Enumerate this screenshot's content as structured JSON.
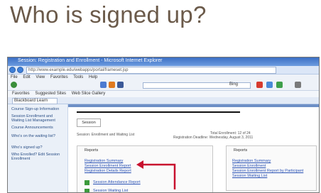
{
  "slide": {
    "title": "Who is signed up?"
  },
  "browser": {
    "title_text": "Session: Registration and Enrollment - Microsoft Internet Explorer",
    "address": "http://www.example.edu/webapps/portal/frameset.jsp",
    "menu": [
      "File",
      "Edit",
      "View",
      "Favorites",
      "Tools",
      "Help"
    ],
    "search_label": "Bing",
    "favorites": [
      "Favorites",
      "Suggested Sites",
      "Web Slice Gallery"
    ],
    "tab_label": "Blackboard Learn"
  },
  "left_nav": {
    "items": [
      "Course Sign-up Information",
      "Session Enrollment and Waiting List Management",
      "Course Announcements",
      "Who's on the waiting list?",
      "Who's signed up?",
      "Who Enrolled? Edit Session Enrollment"
    ]
  },
  "page": {
    "nav_box": "Session",
    "line_a": "Session: Enrollment and Waiting List",
    "line_b": "Total Enrollment: 12 of 24",
    "line_c": "Registration Deadline: Wednesday, August 3, 2011"
  },
  "panels": {
    "left": {
      "heading": "Reports",
      "links": [
        "Registration Summary",
        "Session Enrollment Report",
        "Registration Details Report"
      ],
      "extra": [
        "Session Attendance Report",
        "Session Waiting List"
      ]
    },
    "right": {
      "heading": "Reports",
      "links": [
        "Registration Summary",
        "Session Enrollment",
        "Session Enrollment Report by Participant",
        "Session Waiting List"
      ]
    }
  },
  "colors": {
    "title": "#6b5a4a",
    "arrow": "#c8102e",
    "link": "#2a52b5"
  },
  "icons": [
    "back-icon",
    "forward-icon",
    "home-icon",
    "star-icon",
    "settings-icon"
  ]
}
